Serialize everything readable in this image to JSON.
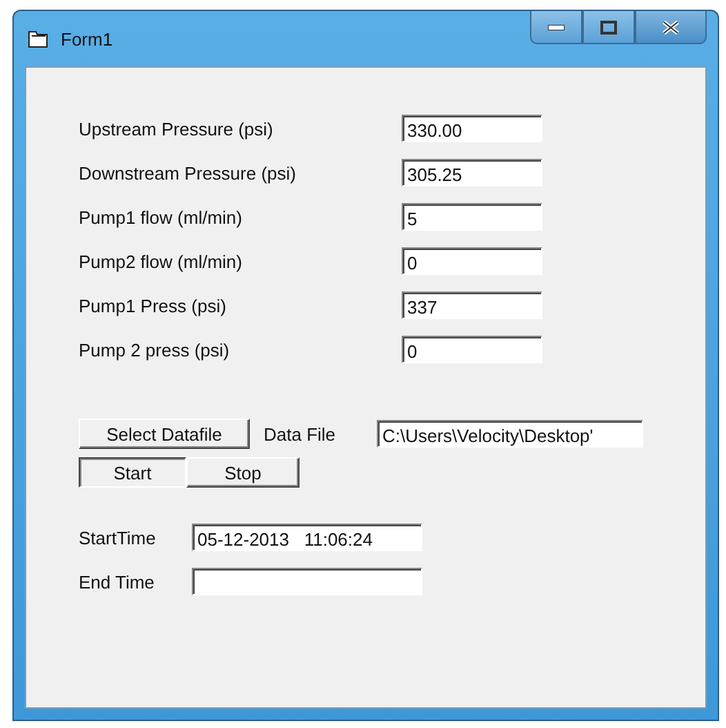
{
  "window": {
    "title": "Form1"
  },
  "fields": [
    {
      "label": "Upstream Pressure (psi)",
      "value": "330.00"
    },
    {
      "label": "Downstream Pressure (psi)",
      "value": "305.25"
    },
    {
      "label": "Pump1 flow (ml/min)",
      "value": "5"
    },
    {
      "label": "Pump2 flow (ml/min)",
      "value": "0"
    },
    {
      "label": "Pump1 Press (psi)",
      "value": "337"
    },
    {
      "label": "Pump 2 press (psi)",
      "value": "0"
    }
  ],
  "select_button": "Select Datafile",
  "data_file": {
    "label": "Data File",
    "value": "C:\\Users\\Velocity\\Desktop'"
  },
  "run_buttons": [
    {
      "label": "Start",
      "pressed": true
    },
    {
      "label": "Stop",
      "pressed": false
    }
  ],
  "times": [
    {
      "label": "StartTime",
      "value": "05-12-2013   11:06:24"
    },
    {
      "label": "End Time"
    }
  ]
}
